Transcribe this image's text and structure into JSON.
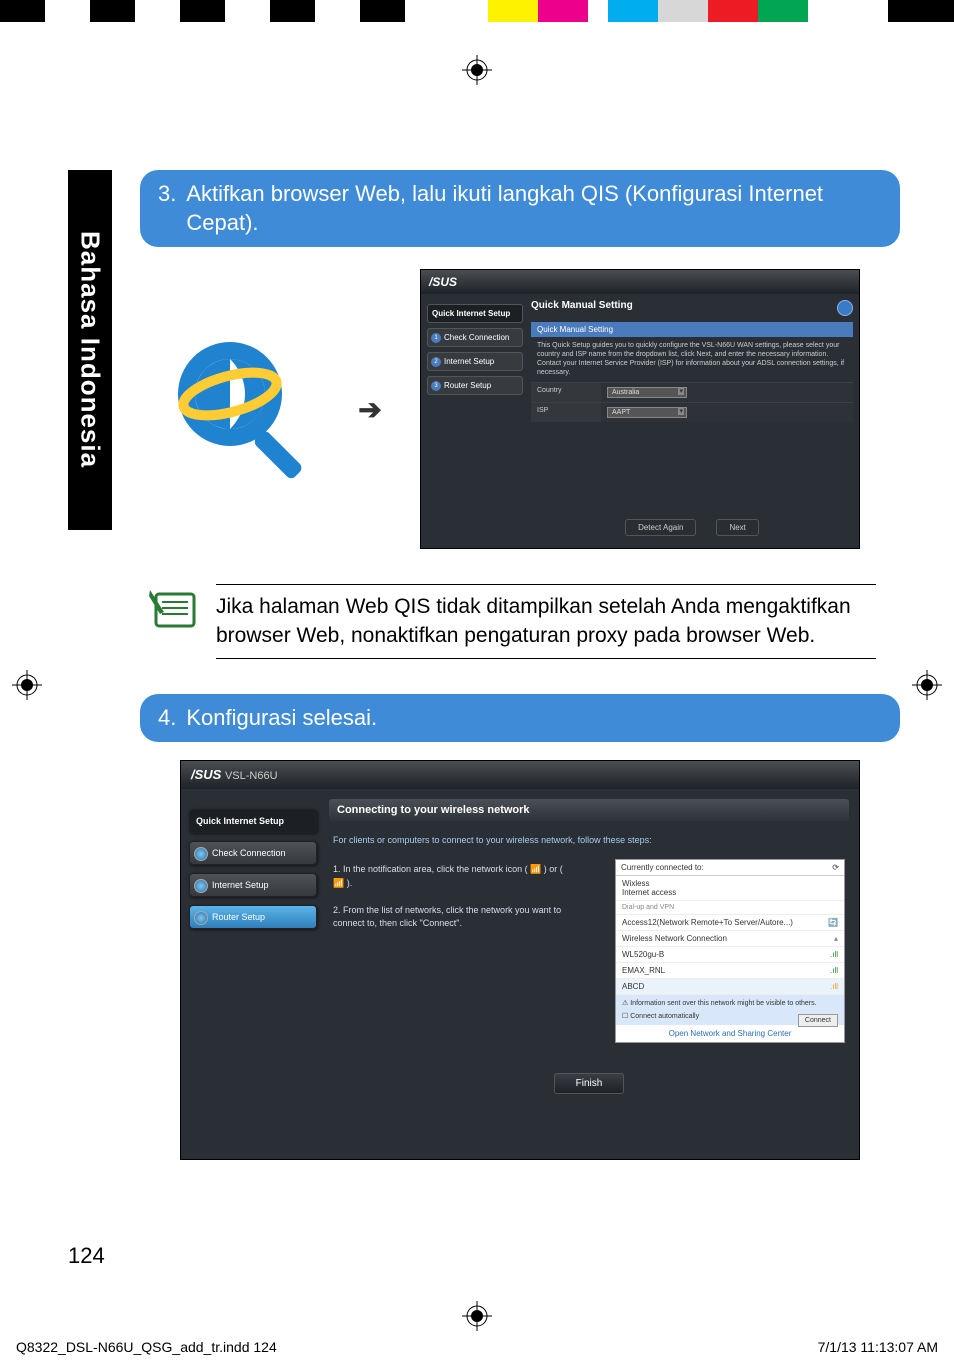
{
  "colorBars": [
    "#000",
    "#fff",
    "#000",
    "#fff",
    "#000",
    "#fff",
    "#000",
    "#fff",
    "#000",
    "#fff",
    "#fff200",
    "#ec008c",
    "#fff",
    "#00aeef",
    "#d7d7d7",
    "#ed1c24",
    "#00a651",
    "#fff",
    "#000"
  ],
  "sideTab": "Bahasa Indonesia",
  "step3": {
    "num": "3.",
    "text": "Aktifkan browser Web, lalu ikuti langkah QIS (Konfigurasi Internet Cepat)."
  },
  "ui1": {
    "brand": "/SUS",
    "sideTitle": "Quick Internet Setup",
    "side": [
      {
        "n": "1",
        "t": "Check Connection"
      },
      {
        "n": "2",
        "t": "Internet Setup"
      },
      {
        "n": "3",
        "t": "Router Setup"
      }
    ],
    "mainTitle": "Quick Manual Setting",
    "barHead": "Quick Manual Setting",
    "desc": "This Quick Setup guides you to quickly configure the VSL-N66U WAN settings, please select your country and ISP name from the dropdown list, click Next, and enter the necessary information. Contact your Internet Service Provider (ISP) for information about your ADSL connection settings, if necessary.",
    "rows": [
      {
        "label": "Country",
        "value": "Australia"
      },
      {
        "label": "ISP",
        "value": "AAPT"
      }
    ],
    "buttons": [
      "Detect Again",
      "Next"
    ]
  },
  "note": "Jika halaman Web QIS tidak ditampilkan setelah Anda mengaktifkan browser Web, nonaktifkan pengaturan proxy pada browser Web.",
  "step4": {
    "num": "4.",
    "text": "Konfigurasi selesai."
  },
  "ui2": {
    "brand": "/SUS",
    "model": "VSL-N66U",
    "sideTitle": "Quick Internet Setup",
    "side": [
      "Check Connection",
      "Internet Setup",
      "Router Setup"
    ],
    "title": "Connecting to your wireless network",
    "subtext": "For clients or computers to connect to your wireless network, follow these steps:",
    "steps": "1. In the notification area, click the network icon ( 📶 ) or ( 📶 ).\n\n2. From the list of networks, click the network you want to connect to, then click \"Connect\".",
    "popup": {
      "hdr": "Currently connected to:",
      "main": "Wixless\nInternet access",
      "section": "Dial-up and VPN",
      "items": [
        "Access12(Network Remote+To Server/Autore...)",
        "Wireless Network Connection",
        "WL520gu-B",
        "EMAX_RNL"
      ],
      "hl_name": "ABCD",
      "hl": "Information sent over this network might be visible to others.",
      "auto": "Connect automatically",
      "connect": "Connect",
      "footer": "Open Network and Sharing Center"
    },
    "finish": "Finish"
  },
  "pageNum": "124",
  "footerFile": "Q8322_DSL-N66U_QSG_add_tr.indd   124",
  "footerDate": "7/1/13   11:13:07 AM"
}
